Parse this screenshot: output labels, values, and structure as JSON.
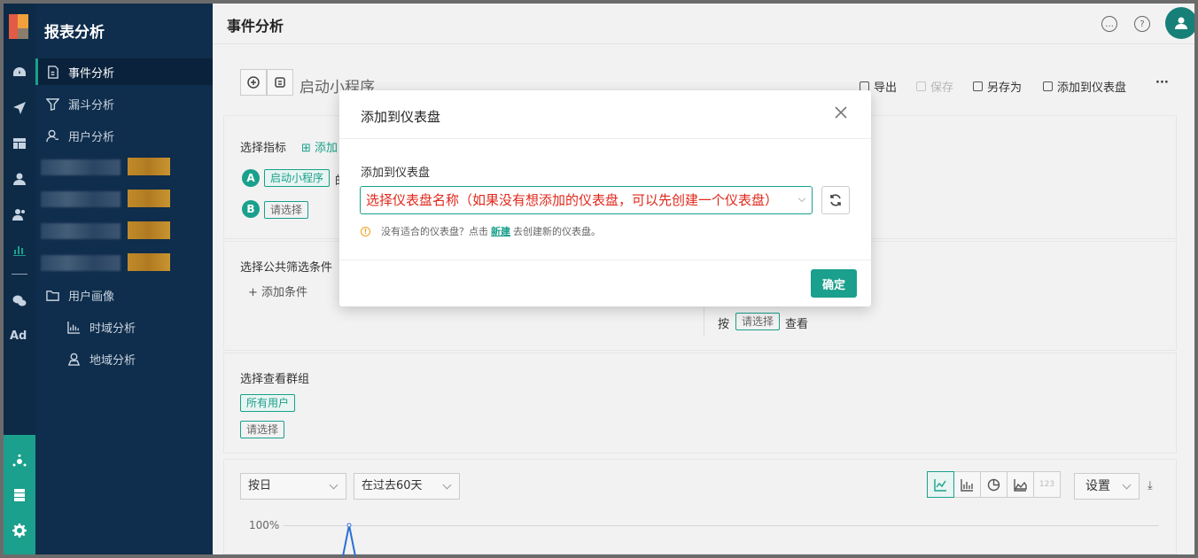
{
  "sidebar": {
    "title": "报表分析",
    "items": [
      {
        "label": "事件分析"
      },
      {
        "label": "漏斗分析"
      },
      {
        "label": "用户分析"
      },
      {
        "label": "用户画像"
      },
      {
        "label": "时域分析"
      },
      {
        "label": "地域分析"
      }
    ],
    "rail_ad": "Ad"
  },
  "header": {
    "title": "事件分析",
    "chat_icon": "…",
    "help_icon": "?"
  },
  "toolbar": {
    "analysis_name": "启动小程序",
    "export": "导出",
    "save": "保存",
    "save_as": "另存为",
    "add_to_dashboard": "添加到仪表盘",
    "more": "···"
  },
  "metrics": {
    "label": "选择指标",
    "add_label": "添加",
    "a_badge": "A",
    "b_badge": "B",
    "a_tag": "启动小程序",
    "a_suffix": "的",
    "b_tag": "请选择"
  },
  "filters": {
    "label": "选择公共筛选条件",
    "add_condition": "添加条件",
    "group_by_prefix": "按",
    "group_by_tag": "请选择",
    "group_by_suffix": "查看"
  },
  "groups": {
    "label": "选择查看群组",
    "all_users": "所有用户",
    "select": "请选择"
  },
  "chart_controls": {
    "granularity": "按日",
    "range": "在过去60天",
    "number_tab": "123",
    "settings": "设置",
    "y_tick": "100%"
  },
  "modal": {
    "title": "添加到仪表盘",
    "field_label": "添加到仪表盘",
    "select_value": "选择仪表盘名称（如果没有想添加的仪表盘，可以先创建一个仪表盘）",
    "hint_prefix": "没有适合的仪表盘？点击",
    "hint_link": "新建",
    "hint_suffix": "去创建新的仪表盘。",
    "confirm": "确定"
  }
}
